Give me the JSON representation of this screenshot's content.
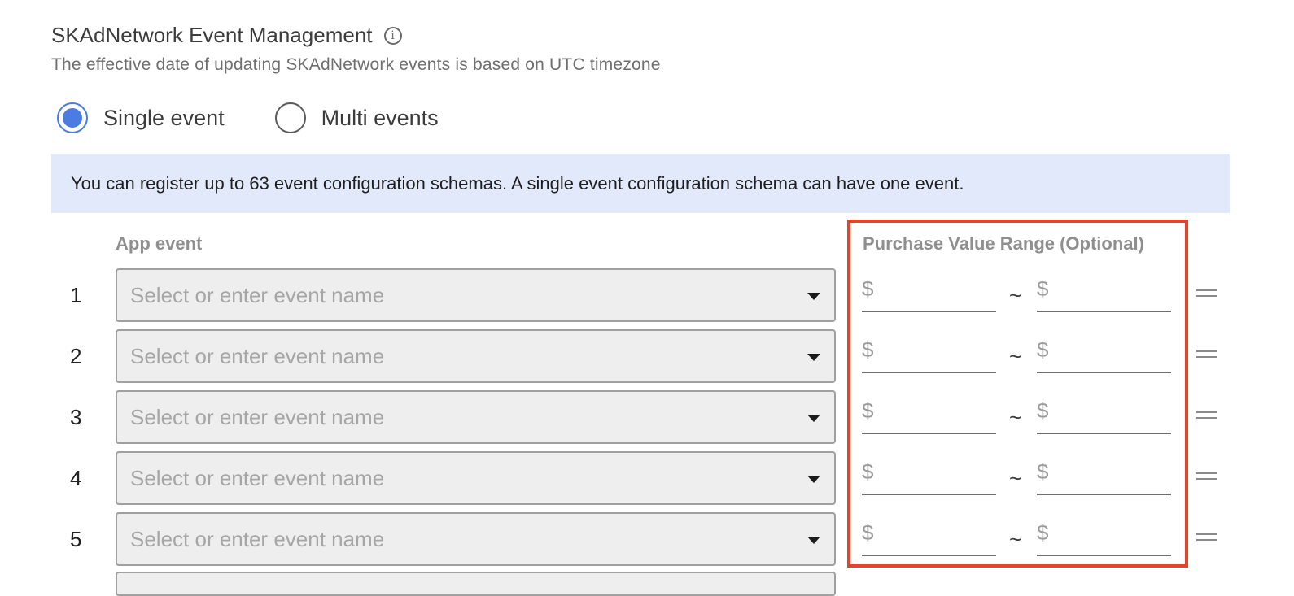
{
  "section": {
    "title": "SKAdNetwork Event Management",
    "info_icon": "info-icon",
    "info_icon_glyph": "i",
    "subtitle": "The effective date of updating SKAdNetwork events is based on UTC timezone"
  },
  "event_mode": {
    "options": [
      {
        "label": "Single event",
        "checked": true
      },
      {
        "label": "Multi events",
        "checked": false
      }
    ]
  },
  "banner": {
    "text": "You can register up to 63 event configuration schemas. A single event configuration schema can have one event."
  },
  "table": {
    "headers": {
      "app_event": "App event",
      "purchase_value_range": "Purchase Value Range (Optional)"
    },
    "rows": [
      {
        "number": "1",
        "event_placeholder": "Select or enter event name",
        "currency_min": "$",
        "separator": "~",
        "currency_max": "$"
      },
      {
        "number": "2",
        "event_placeholder": "Select or enter event name",
        "currency_min": "$",
        "separator": "~",
        "currency_max": "$"
      },
      {
        "number": "3",
        "event_placeholder": "Select or enter event name",
        "currency_min": "$",
        "separator": "~",
        "currency_max": "$"
      },
      {
        "number": "4",
        "event_placeholder": "Select or enter event name",
        "currency_min": "$",
        "separator": "~",
        "currency_max": "$"
      },
      {
        "number": "5",
        "event_placeholder": "Select or enter event name",
        "currency_min": "$",
        "separator": "~",
        "currency_max": "$"
      }
    ]
  },
  "colors": {
    "accent": "#4c7be1",
    "banner_bg": "#e1e9fb",
    "highlight_border": "#e4432c"
  }
}
